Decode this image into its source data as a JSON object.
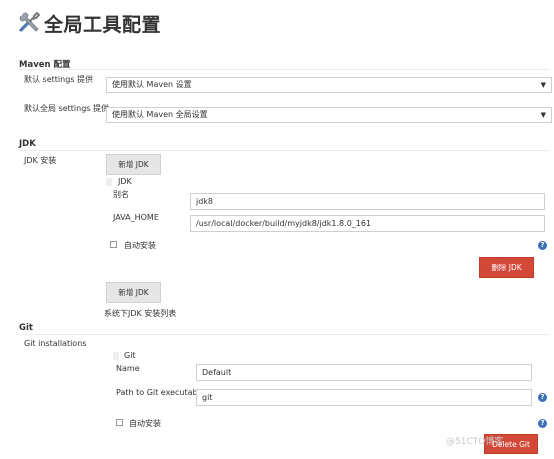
{
  "page": {
    "title": "全局工具配置"
  },
  "maven": {
    "section_title": "Maven 配置",
    "settings_label": "默认 settings 提供",
    "settings_value": "使用默认 Maven 设置",
    "global_settings_label": "默认全局 settings 提供",
    "global_settings_value": "使用默认 Maven 全局设置"
  },
  "jdk": {
    "section_title": "JDK",
    "install_label": "JDK 安装",
    "add_button": "新增 JDK",
    "item_title": "JDK",
    "alias_label": "别名",
    "alias_value": "jdk8",
    "home_label": "JAVA_HOME",
    "home_value": "/usr/local/docker/build/myjdk8/jdk1.8.0_161",
    "auto_install_label": "自动安装",
    "delete_button": "删除 JDK",
    "add_button_2": "新增 JDK",
    "list_note": "系统下JDK 安装列表"
  },
  "git": {
    "section_title": "Git",
    "installations_label": "Git installations",
    "item_title": "Git",
    "name_label": "Name",
    "name_value": "Default",
    "path_label": "Path to Git executable",
    "path_value": "git",
    "auto_install_label": "自动安装",
    "delete_button": "Delete Git"
  },
  "help": {
    "glyph": "?"
  },
  "select": {
    "arrow_glyph": "▼"
  },
  "watermark": {
    "text": "@51CTO博客"
  }
}
